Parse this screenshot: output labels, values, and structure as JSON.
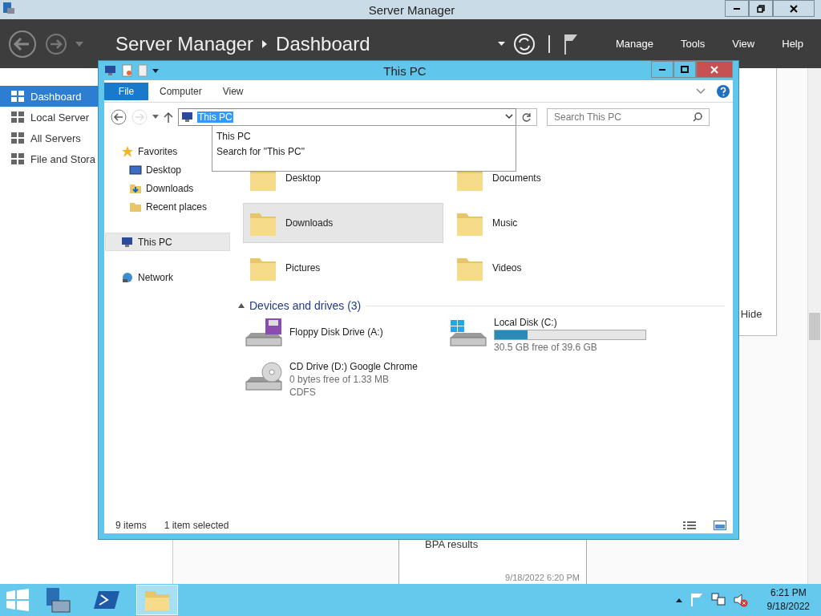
{
  "server_manager": {
    "window_title": "Server Manager",
    "breadcrumb": [
      "Server Manager",
      "Dashboard"
    ],
    "menu": [
      "Manage",
      "Tools",
      "View",
      "Help"
    ],
    "sidebar": [
      {
        "label": "Dashboard",
        "selected": true
      },
      {
        "label": "Local Server",
        "selected": false
      },
      {
        "label": "All Servers",
        "selected": false
      },
      {
        "label": "File and Stora",
        "selected": false
      }
    ],
    "hide_button": "Hide",
    "tile": {
      "title": "BPA results",
      "time": "9/18/2022 6:20 PM"
    }
  },
  "explorer": {
    "title": "This PC",
    "ribbon_tabs": [
      {
        "label": "File",
        "selected": true
      },
      {
        "label": "Computer",
        "selected": false
      },
      {
        "label": "View",
        "selected": false
      }
    ],
    "address": "This PC",
    "search_placeholder": "Search This PC",
    "suggestions": [
      "This PC",
      "Search for \"This PC\""
    ],
    "nav": [
      {
        "label": "Favorites",
        "kind": "favorites",
        "selected": false,
        "children": [
          {
            "label": "Desktop",
            "kind": "desktop",
            "selected": false
          },
          {
            "label": "Downloads",
            "kind": "downloads",
            "selected": false
          },
          {
            "label": "Recent places",
            "kind": "recent",
            "selected": false
          }
        ]
      },
      {
        "label": "This PC",
        "kind": "pc",
        "selected": true
      },
      {
        "label": "Network",
        "kind": "network",
        "selected": false
      }
    ],
    "folders": [
      {
        "name": "Desktop",
        "selected": false
      },
      {
        "name": "Documents",
        "selected": false
      },
      {
        "name": "Downloads",
        "selected": true
      },
      {
        "name": "Music",
        "selected": false
      },
      {
        "name": "Pictures",
        "selected": false
      },
      {
        "name": "Videos",
        "selected": false
      }
    ],
    "devices_title": "Devices and drives (3)",
    "drives": [
      {
        "kind": "floppy",
        "name": "Floppy Disk Drive (A:)"
      },
      {
        "kind": "disk",
        "name": "Local Disk (C:)",
        "level": 0.22,
        "details": [
          "30.5 GB free of 39.6 GB"
        ]
      },
      {
        "kind": "cd",
        "name": "CD Drive (D:) Google Chrome",
        "details": [
          "0 bytes free of 1.33 MB",
          "CDFS"
        ]
      }
    ],
    "status": [
      "9 items",
      "1 item selected"
    ]
  },
  "taskbar": {
    "apps": [
      {
        "kind": "server-manager",
        "selected": false
      },
      {
        "kind": "powershell",
        "selected": false
      },
      {
        "kind": "explorer",
        "selected": true
      }
    ],
    "time": "6:21 PM",
    "date": "9/18/2022"
  }
}
